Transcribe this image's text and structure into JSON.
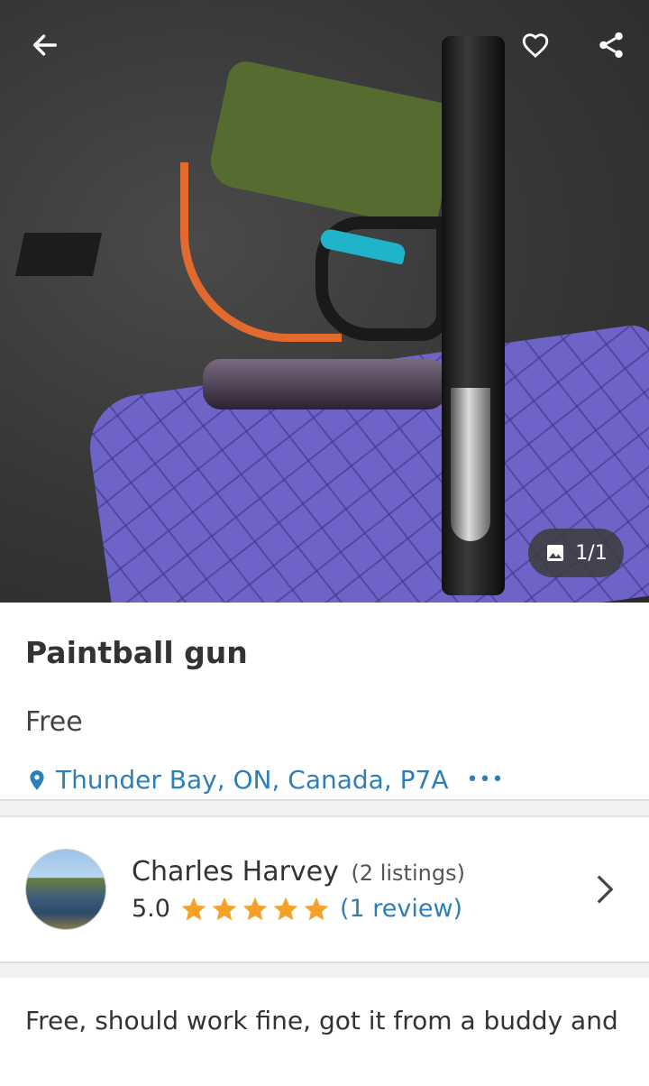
{
  "header": {
    "back_icon": "arrow-left-icon",
    "favorite_icon": "heart-outline-icon",
    "share_icon": "share-icon"
  },
  "photo": {
    "counter": "1/1",
    "counter_icon": "image-icon"
  },
  "listing": {
    "title": "Paintball gun",
    "price": "Free",
    "location": "Thunder Bay, ON, Canada, P7A",
    "location_icon": "location-pin-icon",
    "more": "•••"
  },
  "seller": {
    "name": "Charles Harvey",
    "listings": "(2 listings)",
    "rating": "5.0",
    "stars": 5,
    "reviews": "(1 review)",
    "star_color": "#f4a12a"
  },
  "description": {
    "text": "Free, should work fine, got it from a buddy and"
  },
  "colors": {
    "link": "#2d7fb8",
    "star": "#f4a12a"
  }
}
